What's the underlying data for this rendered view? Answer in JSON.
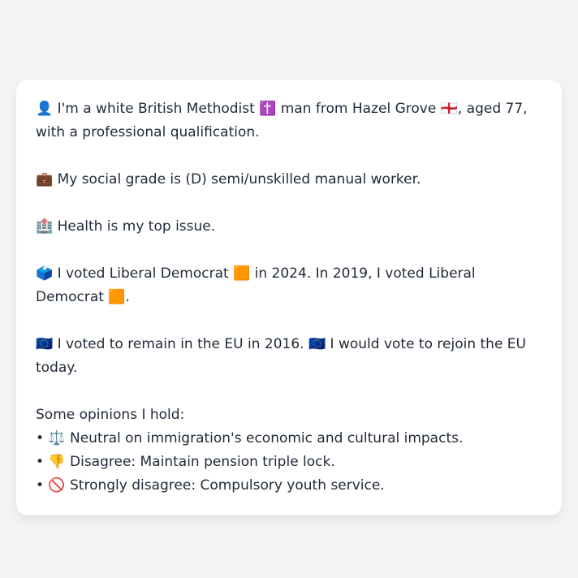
{
  "bubble": {
    "identity": "👤 I'm a white British Methodist ✝️ man from Hazel Grove 🏴󠁧󠁢󠁥󠁮󠁧󠁿, aged 77, with a professional qualification.",
    "grade": "💼 My social grade is (D) semi/unskilled manual worker.",
    "issue": "🏥 Health is my top issue.",
    "vote": "🗳️ I voted Liberal Democrat 🟧 in 2024. In 2019, I voted Liberal Democrat 🟧.",
    "eu": "🇪🇺 I voted to remain in the EU in 2016. 🇪🇺 I would vote to rejoin the EU today.",
    "opinions_heading": "Some opinions I hold:",
    "opinions": [
      "• ⚖️ Neutral on immigration's economic and cultural impacts.",
      "• 👎 Disagree: Maintain pension triple lock.",
      "• 🚫 Strongly disagree: Compulsory youth service."
    ]
  }
}
